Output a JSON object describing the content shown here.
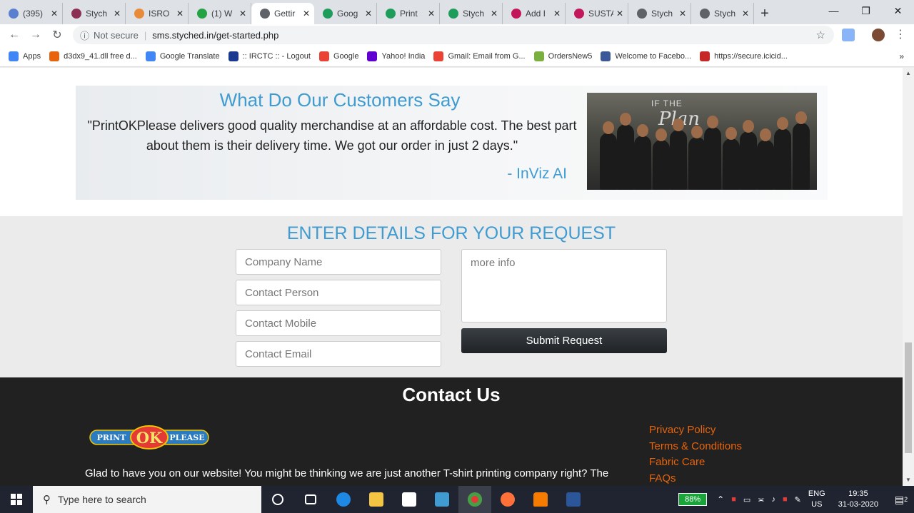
{
  "browser": {
    "tabs": [
      {
        "label": "(395)",
        "color": "#5b7fd0"
      },
      {
        "label": "Stych",
        "color": "#8b2f54"
      },
      {
        "label": "ISRO",
        "color": "#e88a3a"
      },
      {
        "label": "(1) W",
        "color": "#25a244"
      },
      {
        "label": "Gettir",
        "color": "#5f6368",
        "active": true
      },
      {
        "label": "Goog",
        "color": "#1e9c5a"
      },
      {
        "label": "Print",
        "color": "#1e9c5a"
      },
      {
        "label": "Stych",
        "color": "#1e9c5a"
      },
      {
        "label": "Add I",
        "color": "#c2185b"
      },
      {
        "label": "SUSTA",
        "color": "#c2185b"
      },
      {
        "label": "Stych",
        "color": "#5f6368"
      },
      {
        "label": "Stych",
        "color": "#5f6368"
      }
    ],
    "security": "Not secure",
    "url": "sms.styched.in/get-started.php",
    "bookmarks": [
      {
        "label": "Apps",
        "color": "#4285f4"
      },
      {
        "label": "d3dx9_41.dll free d...",
        "color": "#e8640c"
      },
      {
        "label": "Google Translate",
        "color": "#4285f4"
      },
      {
        "label": ":: IRCTC :: - Logout",
        "color": "#1a3a8f"
      },
      {
        "label": "Google",
        "color": "#ea4335"
      },
      {
        "label": "Yahoo! India",
        "color": "#6001d2"
      },
      {
        "label": "Gmail: Email from G...",
        "color": "#ea4335"
      },
      {
        "label": "OrdersNew5",
        "color": "#7ab03f"
      },
      {
        "label": "Welcome to Facebo...",
        "color": "#3b5998"
      },
      {
        "label": "https://secure.icicid...",
        "color": "#c62828"
      }
    ]
  },
  "testimonial": {
    "title": "What Do Our Customers Say",
    "quote": "\"PrintOKPlease delivers good quality merchandise at an affordable cost. The best part about them is their delivery time. We got our order in just 2 days.\"",
    "author": "- InViz AI",
    "photo_sign_top": "IF THE",
    "photo_sign_main": "Plan"
  },
  "form": {
    "title": "ENTER DETAILS FOR YOUR REQUEST",
    "company_placeholder": "Company Name",
    "person_placeholder": "Contact Person",
    "mobile_placeholder": "Contact Mobile",
    "email_placeholder": "Contact Email",
    "info_placeholder": "more info",
    "submit_label": "Submit Request"
  },
  "footer": {
    "title": "Contact Us",
    "logo": {
      "left": "PRINT",
      "mid": "OK",
      "right": "PLEASE"
    },
    "text": "Glad to have you on our website! You might be thinking we are just another T-shirt printing company right? The",
    "links": [
      "Privacy Policy",
      "Terms & Conditions",
      "Fabric Care",
      "FAQs"
    ]
  },
  "taskbar": {
    "search_placeholder": "Type here to search",
    "battery": "88%",
    "lang_top": "ENG",
    "lang_bottom": "US",
    "time": "19:35",
    "date": "31-03-2020",
    "notifications": "2"
  }
}
